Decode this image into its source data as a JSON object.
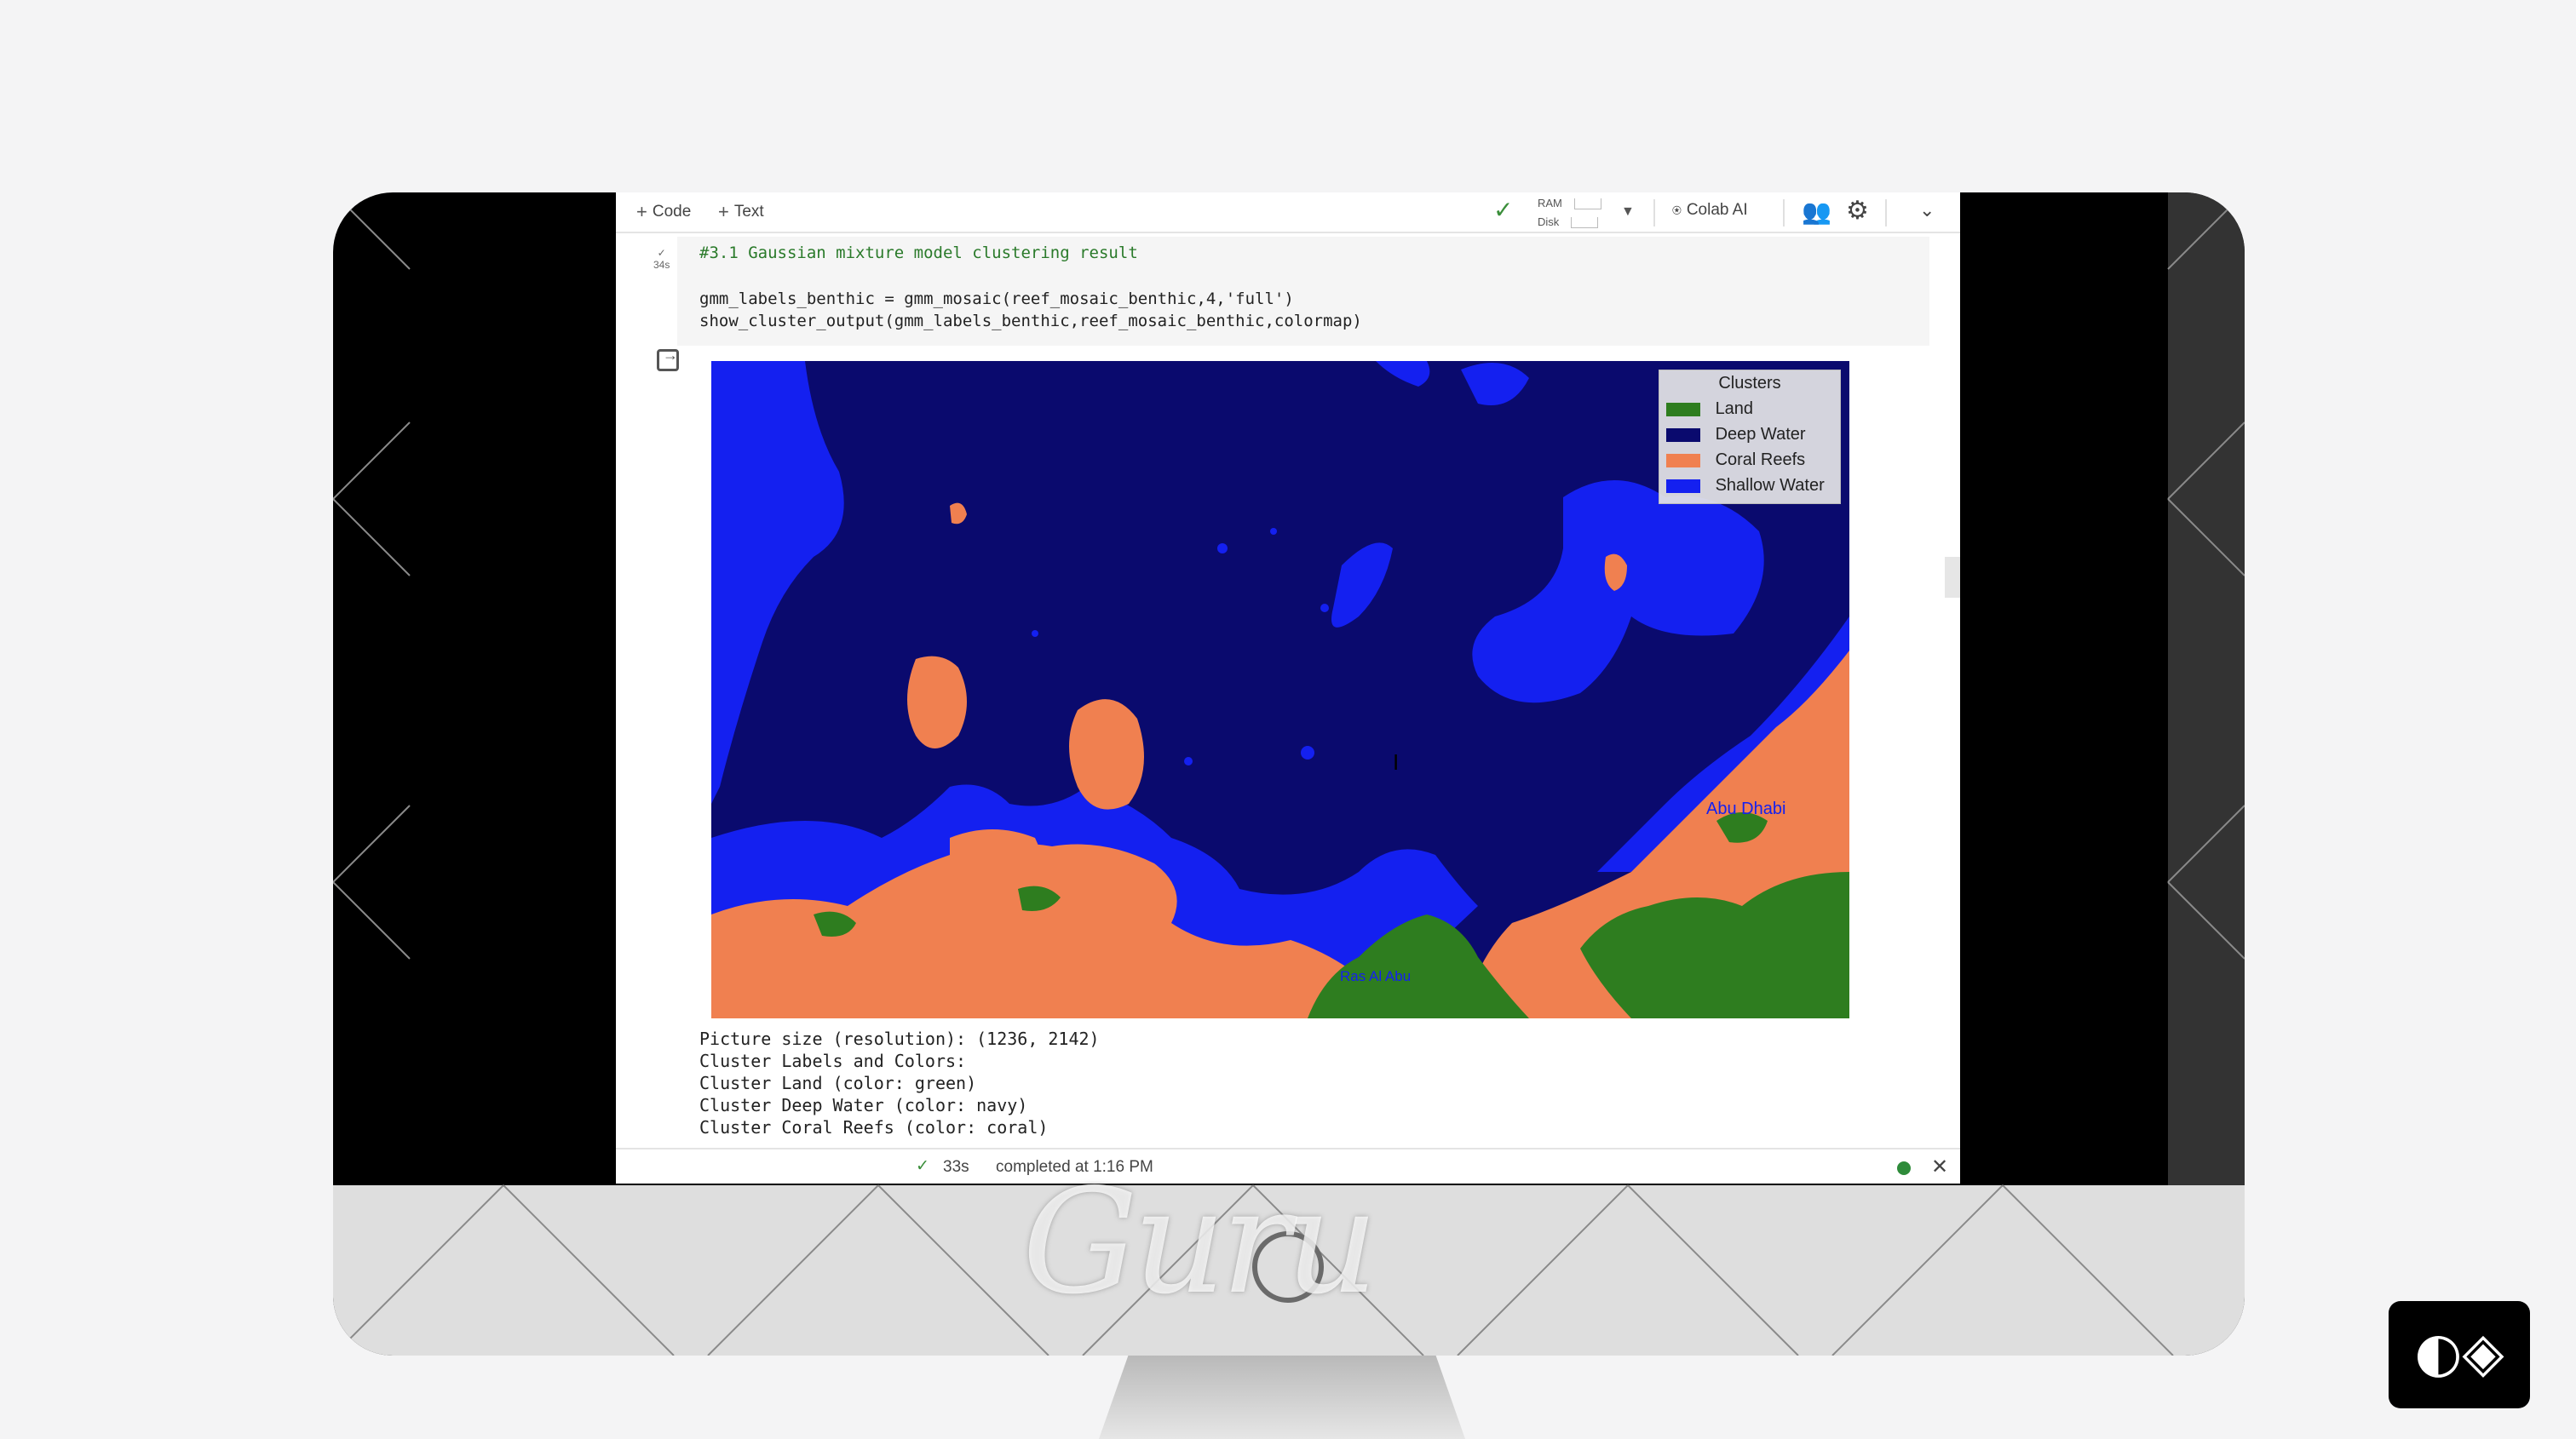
{
  "toolbar": {
    "code_label": "Code",
    "text_label": "Text",
    "ram_label": "RAM",
    "disk_label": "Disk",
    "colab_ai_label": "Colab AI"
  },
  "cell": {
    "duration": "34s",
    "lines": [
      "#3.1 Gaussian mixture model clustering result",
      "",
      "gmm_labels_benthic = gmm_mosaic(reef_mosaic_benthic,4,'full')",
      "show_cluster_output(gmm_labels_benthic,reef_mosaic_benthic,colormap)"
    ]
  },
  "plot": {
    "legend_title": "Clusters",
    "legend": [
      {
        "label": "Land",
        "color": "#2e7d1f"
      },
      {
        "label": "Deep Water",
        "color": "#0a0a6e"
      },
      {
        "label": "Coral Reefs",
        "color": "#f08050"
      },
      {
        "label": "Shallow Water",
        "color": "#1420f0"
      }
    ],
    "map_labels": [
      "Abu Dhabi",
      "Ras Al Abu"
    ]
  },
  "output": {
    "lines": [
      "Picture size (resolution): (1236, 2142)",
      "Cluster Labels and Colors:",
      "Cluster Land (color: green)",
      "Cluster Deep Water (color: navy)",
      "Cluster Coral Reefs (color: coral)"
    ]
  },
  "status": {
    "duration": "33s",
    "completed": "completed at 1:16 PM"
  },
  "watermark": "Guru"
}
